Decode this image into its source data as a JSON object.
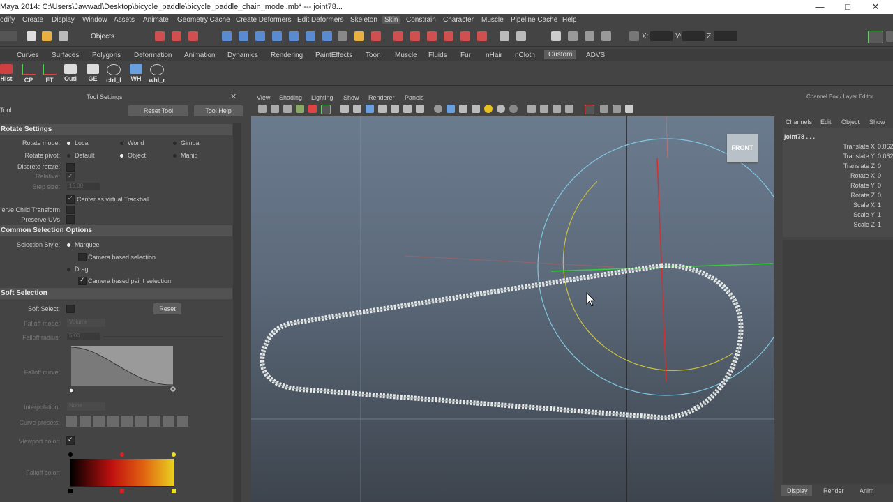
{
  "window": {
    "title": "Maya 2014: C:\\Users\\Jawwad\\Desktop\\bicycle_paddle\\bicycle_paddle_chain_model.mb* --- joint78...",
    "controls": [
      "—",
      "□",
      "✕"
    ]
  },
  "menubar": [
    "odify",
    "Create",
    "Display",
    "Window",
    "Assets",
    "Animate",
    "Geometry Cache",
    "Create Deformers",
    "Edit Deformers",
    "Skeleton",
    "Skin",
    "Constrain",
    "Character",
    "Muscle",
    "Pipeline Cache",
    "Help"
  ],
  "menubar_selected": "Skin",
  "statusline": {
    "selection_mode": "Objects",
    "x_label": "X:",
    "y_label": "Y:",
    "z_label": "Z:"
  },
  "shelf_tabs": [
    "Curves",
    "Surfaces",
    "Polygons",
    "Deformation",
    "Animation",
    "Dynamics",
    "Rendering",
    "PaintEffects",
    "Toon",
    "Muscle",
    "Fluids",
    "Fur",
    "nHair",
    "nCloth",
    "Custom",
    "ADVS"
  ],
  "shelf_active_tab": "Custom",
  "shelf_buttons": [
    "Hist",
    "CP",
    "FT",
    "Outl",
    "GE",
    "ctrl_l",
    "WH",
    "whl_r"
  ],
  "tool_settings": {
    "panel_title": "Tool Settings",
    "tool_name": "Tool",
    "reset_button": "Reset Tool",
    "help_button": "Tool Help",
    "rotate_section": "Rotate Settings",
    "rotate_mode_label": "Rotate mode:",
    "rotate_mode_options": [
      "Local",
      "World",
      "Gimbal"
    ],
    "rotate_pivot_label": "Rotate pivot:",
    "rotate_pivot_options": [
      "Default",
      "Object",
      "Manip"
    ],
    "discrete_rotate_label": "Discrete rotate:",
    "relative_label": "Relative:",
    "step_size_label": "Step size:",
    "step_size_value": "15.00",
    "center_trackball_label": "Center as virtual Trackball",
    "preserve_child_label": "erve Child Transform",
    "preserve_uvs_label": "Preserve UVs",
    "common_selection_section": "Common Selection Options",
    "selection_style_label": "Selection Style:",
    "marquee_label": "Marquee",
    "camera_based_selection_label": "Camera based selection",
    "drag_label": "Drag",
    "camera_based_paint_label": "Camera based paint selection",
    "soft_selection_section": "Soft Selection",
    "soft_select_label": "Soft Select:",
    "soft_reset_button": "Reset",
    "falloff_mode_label": "Falloff mode:",
    "falloff_mode_value": "Volume",
    "falloff_radius_label": "Falloff radius:",
    "falloff_radius_value": "5.00",
    "falloff_curve_label": "Falloff curve:",
    "interpolation_label": "Interpolation:",
    "interpolation_value": "None",
    "curve_presets_label": "Curve presets:",
    "viewport_color_label": "Viewport color:",
    "falloff_color_label": "Falloff color:"
  },
  "viewport": {
    "menus": [
      "View",
      "Shading",
      "Lighting",
      "Show",
      "Renderer",
      "Panels"
    ],
    "viewcube_label": "FRONT"
  },
  "channel_box": {
    "title": "Channel Box / Layer Editor",
    "menus": [
      "Channels",
      "Edit",
      "Object",
      "Show"
    ],
    "object_name": "joint78 . . .",
    "attributes": [
      {
        "name": "Translate X",
        "value": "0.062"
      },
      {
        "name": "Translate Y",
        "value": "0.062"
      },
      {
        "name": "Translate Z",
        "value": "0"
      },
      {
        "name": "Rotate X",
        "value": "0"
      },
      {
        "name": "Rotate Y",
        "value": "0"
      },
      {
        "name": "Rotate Z",
        "value": "0"
      },
      {
        "name": "Scale X",
        "value": "1"
      },
      {
        "name": "Scale Y",
        "value": "1"
      },
      {
        "name": "Scale Z",
        "value": "1"
      }
    ],
    "bottom_tabs": [
      "Display",
      "Render",
      "Anim"
    ]
  },
  "colors": {
    "background": "#444444",
    "viewport_top": "#6b7b8e",
    "viewport_bottom": "#3d444d",
    "chain": "#e8e8e8",
    "manip_blue": "#7fc6e0",
    "manip_yellow": "#c8c040",
    "axis_green": "#35d035",
    "axis_red": "#d03030"
  }
}
